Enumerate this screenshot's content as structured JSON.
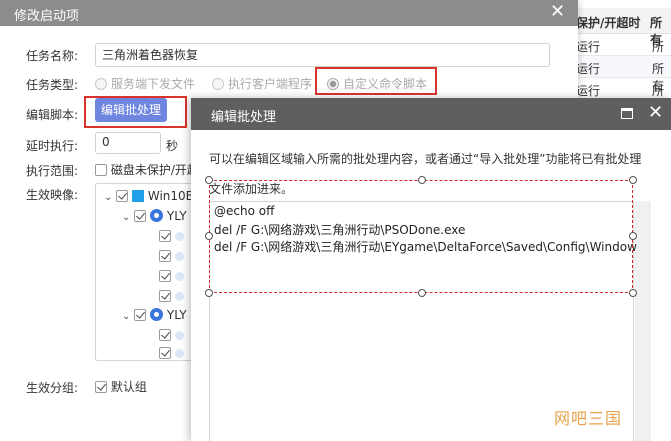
{
  "background_table": {
    "headers": [
      "保护/开超时",
      "所有"
    ],
    "rows": [
      [
        "运行",
        "所有"
      ],
      [
        "运行",
        "所有"
      ],
      [
        "运行",
        "所有"
      ]
    ]
  },
  "main_dialog": {
    "title": "修改启动项",
    "close": "✕",
    "task_name_label": "任务名称:",
    "task_name_value": "三角洲着色器恢复",
    "task_type_label": "任务类型:",
    "task_type_options": [
      "服务端下发文件",
      "执行客户端程序",
      "自定义命令脚本"
    ],
    "task_type_selected": "自定义命令脚本",
    "edit_script_label": "编辑脚本:",
    "edit_script_button": "编辑批处理",
    "delay_label": "延时执行:",
    "delay_value": "0",
    "delay_unit": "秒",
    "scope_label": "执行范围:",
    "scope_checkbox": "磁盘未保护/开超",
    "image_label": "生效映像:",
    "tree": {
      "root": "Win10B",
      "group1": "YLY",
      "group2": "YLY"
    },
    "group_label": "生效分组:",
    "group_value": "默认组"
  },
  "batch_dialog": {
    "title": "编辑批处理",
    "maximize": "□",
    "close": "✕",
    "description_line1": "可以在编辑区域输入所需的批处理内容，或者通过“导入批处理”功能将已有批处理",
    "description_line2": "文件添加进来。",
    "code_lines": [
      "@echo off",
      "del /F G:\\网络游戏\\三角洲行动\\PSODone.exe",
      "del /F G:\\网络游戏\\三角洲行动\\EYgame\\DeltaForce\\Saved\\Config\\Window"
    ]
  },
  "watermark": "网吧三国",
  "colors": {
    "main_title_bar": "#8c8c8c",
    "batch_title_bar": "#5f5f5f",
    "accent_button": "#6f86e0",
    "highlight_red": "#d9342b"
  }
}
